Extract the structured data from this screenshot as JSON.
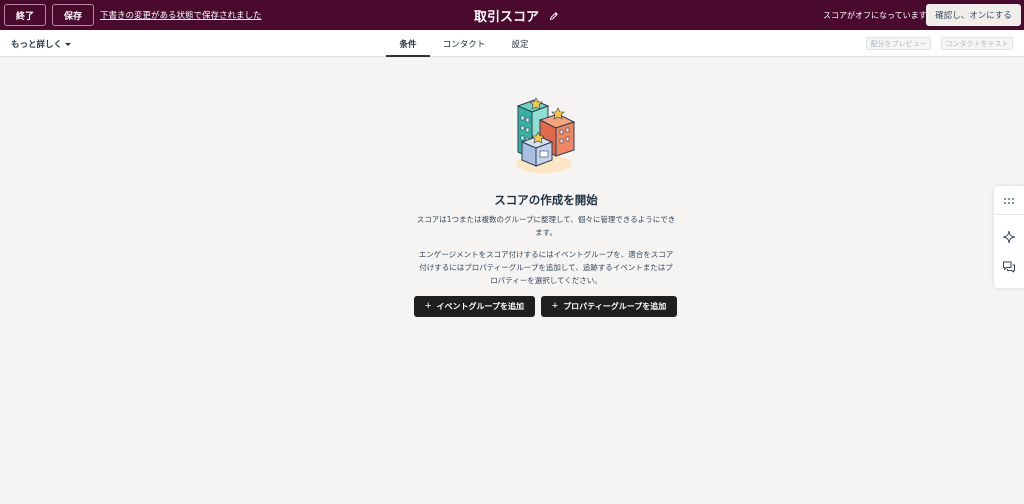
{
  "topbar": {
    "exit_label": "終了",
    "save_label": "保存",
    "draft_status_link": "下書きの変更がある状態で保存されました",
    "title": "取引スコア",
    "score_status": "スコアがオフになっています",
    "review_button": "確認し、オンにする"
  },
  "subbar": {
    "more_details": "もっと詳しく",
    "tabs": [
      {
        "label": "条件",
        "active": true
      },
      {
        "label": "コンタクト",
        "active": false
      },
      {
        "label": "設定",
        "active": false
      }
    ],
    "preview_button": "配分をプレビュー",
    "test_button": "コンタクトをテスト"
  },
  "main": {
    "heading": "スコアの作成を開始",
    "description_1": "スコアは1つまたは複数のグループに整理して、個々に管理できるようにできます。",
    "description_2": "エンゲージメントをスコア付けするにはイベントグループを、適合をスコア付けするにはプロパティーグループを追加して、追跡するイベントまたはプロパティーを選択してください。",
    "add_event_group": "イベントグループを追加",
    "add_property_group": "プロパティーグループを追加"
  },
  "side_panel": {
    "icons": [
      "grid-dots-icon",
      "sparkle-icon",
      "chat-icon"
    ]
  },
  "colors": {
    "topbar_bg": "#4a0a2e",
    "page_bg": "#f5f4f2",
    "primary_button": "#1f1f1f"
  }
}
